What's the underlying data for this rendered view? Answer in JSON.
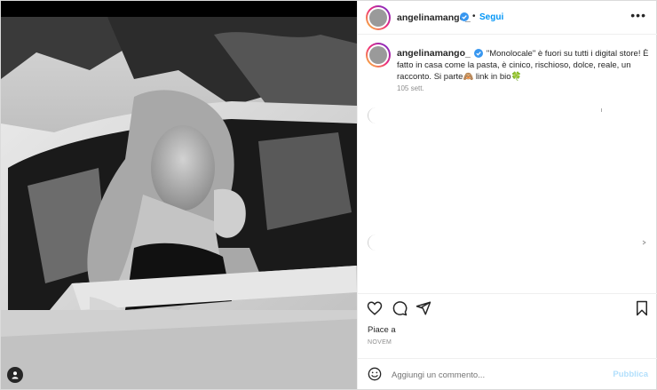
{
  "post": {
    "username": "angelinamango_",
    "follow_label": "Segui",
    "separator": "•",
    "more_label": "•••",
    "caption": "\"Monolocale\" è fuori su tutti i digital store! È fatto in casa come la pasta, è cinico, rischioso, dolce, reale, un racconto. Si parte🙈 link in bio🍀",
    "time_ago": "105 sett.",
    "likes_text": "Piace a",
    "date_text": "NOVEM",
    "comment_placeholder": "Aggiungi un commento...",
    "publish_label": "Pubblica"
  },
  "icons": [
    "user-tag-icon",
    "verified-badge-icon",
    "more-options-icon",
    "heart-icon",
    "comment-icon",
    "share-icon",
    "bookmark-icon",
    "emoji-icon"
  ],
  "colors": {
    "link_blue": "#0095f6",
    "publish_disabled": "#b2dffc",
    "verified": "#3897f0",
    "text": "#262626",
    "muted": "#8e8e8e"
  }
}
